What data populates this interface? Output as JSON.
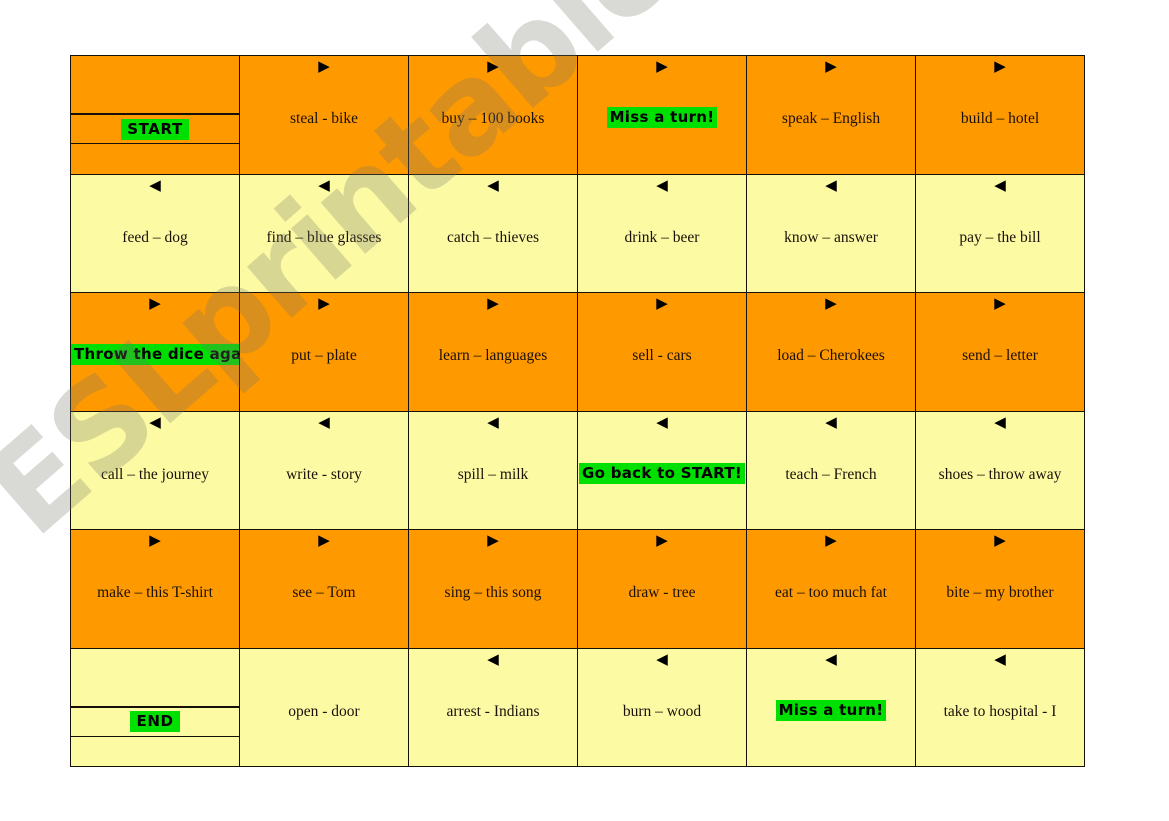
{
  "watermark": {
    "text": "ESLprintables.com"
  },
  "colors": {
    "orange": "#FF9900",
    "yellow": "#FCFBA4",
    "highlight_green": "#00E000",
    "border": "#15100A",
    "page_background": "#FFFFFF"
  },
  "board": {
    "columns": 6,
    "rows": 6,
    "arrow_right": "▶",
    "arrow_left": "◀",
    "cells": [
      [
        {
          "type": "split",
          "color": "orange",
          "arrow": "none",
          "label": "START",
          "highlight": true
        },
        {
          "type": "normal",
          "color": "orange",
          "arrow": "right",
          "label": "steal - bike",
          "highlight": false
        },
        {
          "type": "normal",
          "color": "orange",
          "arrow": "right",
          "label": "buy – 100 books",
          "highlight": false
        },
        {
          "type": "normal",
          "color": "orange",
          "arrow": "right",
          "label": "Miss a turn!",
          "highlight": true
        },
        {
          "type": "normal",
          "color": "orange",
          "arrow": "right",
          "label": "speak – English",
          "highlight": false
        },
        {
          "type": "normal",
          "color": "orange",
          "arrow": "right",
          "label": "build – hotel",
          "highlight": false
        }
      ],
      [
        {
          "type": "normal",
          "color": "yellow",
          "arrow": "left",
          "label": "feed – dog",
          "highlight": false
        },
        {
          "type": "normal",
          "color": "yellow",
          "arrow": "left",
          "label": "find – blue glasses",
          "highlight": false
        },
        {
          "type": "normal",
          "color": "yellow",
          "arrow": "left",
          "label": "catch – thieves",
          "highlight": false
        },
        {
          "type": "normal",
          "color": "yellow",
          "arrow": "left",
          "label": "drink – beer",
          "highlight": false
        },
        {
          "type": "normal",
          "color": "yellow",
          "arrow": "left",
          "label": "know – answer",
          "highlight": false
        },
        {
          "type": "normal",
          "color": "yellow",
          "arrow": "left",
          "label": "pay – the bill",
          "highlight": false
        }
      ],
      [
        {
          "type": "normal",
          "color": "orange",
          "arrow": "right",
          "label": "Throw the dice again!",
          "highlight": true
        },
        {
          "type": "normal",
          "color": "orange",
          "arrow": "right",
          "label": "put – plate",
          "highlight": false
        },
        {
          "type": "normal",
          "color": "orange",
          "arrow": "right",
          "label": "learn – languages",
          "highlight": false
        },
        {
          "type": "normal",
          "color": "orange",
          "arrow": "right",
          "label": "sell - cars",
          "highlight": false
        },
        {
          "type": "normal",
          "color": "orange",
          "arrow": "right",
          "label": "load – Cherokees",
          "highlight": false
        },
        {
          "type": "normal",
          "color": "orange",
          "arrow": "right",
          "label": "send – letter",
          "highlight": false
        }
      ],
      [
        {
          "type": "normal",
          "color": "yellow",
          "arrow": "left",
          "label": "call – the journey",
          "highlight": false
        },
        {
          "type": "normal",
          "color": "yellow",
          "arrow": "left",
          "label": "write - story",
          "highlight": false
        },
        {
          "type": "normal",
          "color": "yellow",
          "arrow": "left",
          "label": "spill – milk",
          "highlight": false
        },
        {
          "type": "normal",
          "color": "yellow",
          "arrow": "left",
          "label": "Go back to START!",
          "highlight": true
        },
        {
          "type": "normal",
          "color": "yellow",
          "arrow": "left",
          "label": "teach – French",
          "highlight": false
        },
        {
          "type": "normal",
          "color": "yellow",
          "arrow": "left",
          "label": "shoes – throw away",
          "highlight": false
        }
      ],
      [
        {
          "type": "normal",
          "color": "orange",
          "arrow": "right",
          "label": "make – this T-shirt",
          "highlight": false
        },
        {
          "type": "normal",
          "color": "orange",
          "arrow": "right",
          "label": "see – Tom",
          "highlight": false
        },
        {
          "type": "normal",
          "color": "orange",
          "arrow": "right",
          "label": "sing – this song",
          "highlight": false
        },
        {
          "type": "normal",
          "color": "orange",
          "arrow": "right",
          "label": "draw - tree",
          "highlight": false
        },
        {
          "type": "normal",
          "color": "orange",
          "arrow": "right",
          "label": "eat – too much fat",
          "highlight": false
        },
        {
          "type": "normal",
          "color": "orange",
          "arrow": "right",
          "label": "bite – my brother",
          "highlight": false
        }
      ],
      [
        {
          "type": "split",
          "color": "yellow",
          "arrow": "none",
          "label": "END",
          "highlight": true
        },
        {
          "type": "normal",
          "color": "yellow",
          "arrow": "none",
          "label": "open - door",
          "highlight": false
        },
        {
          "type": "normal",
          "color": "yellow",
          "arrow": "left",
          "label": "arrest - Indians",
          "highlight": false
        },
        {
          "type": "normal",
          "color": "yellow",
          "arrow": "left",
          "label": "burn – wood",
          "highlight": false
        },
        {
          "type": "normal",
          "color": "yellow",
          "arrow": "left",
          "label": "Miss a turn!",
          "highlight": true
        },
        {
          "type": "normal",
          "color": "yellow",
          "arrow": "left",
          "label": "take to hospital - I",
          "highlight": false
        }
      ]
    ]
  }
}
